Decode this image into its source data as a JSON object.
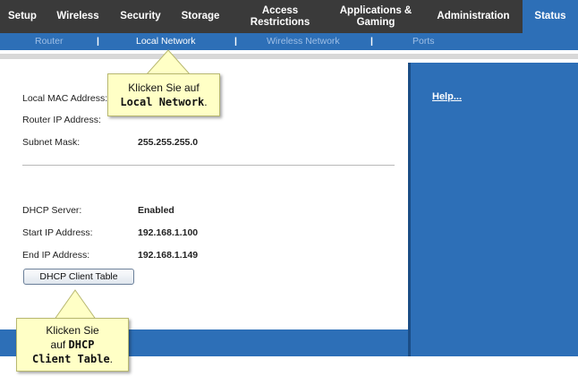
{
  "topnav": {
    "items": [
      {
        "label": "Setup"
      },
      {
        "label": "Wireless"
      },
      {
        "label": "Security"
      },
      {
        "label": "Storage"
      },
      {
        "line1": "Access",
        "line2": "Restrictions"
      },
      {
        "line1": "Applications &",
        "line2": "Gaming"
      },
      {
        "label": "Administration"
      },
      {
        "label": "Status"
      }
    ]
  },
  "subnav": {
    "items": [
      "Router",
      "Local Network",
      "Wireless Network",
      "Ports"
    ],
    "separator": "|"
  },
  "main": {
    "local_mac_label": "Local MAC Address:",
    "router_ip_label": "Router IP Address:",
    "subnet_mask_label": "Subnet Mask:",
    "subnet_mask_value": "255.255.255.0",
    "dhcp_server_label": "DHCP Server:",
    "dhcp_server_value": "Enabled",
    "start_ip_label": "Start IP Address:",
    "start_ip_value": "192.168.1.100",
    "end_ip_label": "End IP Address:",
    "end_ip_value": "192.168.1.149",
    "dhcp_button_label": "DHCP Client Table"
  },
  "side": {
    "help_label": "Help..."
  },
  "callouts": {
    "local_network": {
      "line1": "Klicken Sie auf",
      "bold": "Local Network",
      "tail": "."
    },
    "dhcp_table": {
      "line1": "Klicken Sie",
      "line2_pre": "auf ",
      "line2_bold": "DHCP",
      "bold3": "Client Table",
      "tail": "."
    }
  },
  "colors": {
    "nav_bg": "#3a3a3a",
    "accent_blue": "#2d6fb7",
    "callout_bg": "#ffffc6"
  }
}
